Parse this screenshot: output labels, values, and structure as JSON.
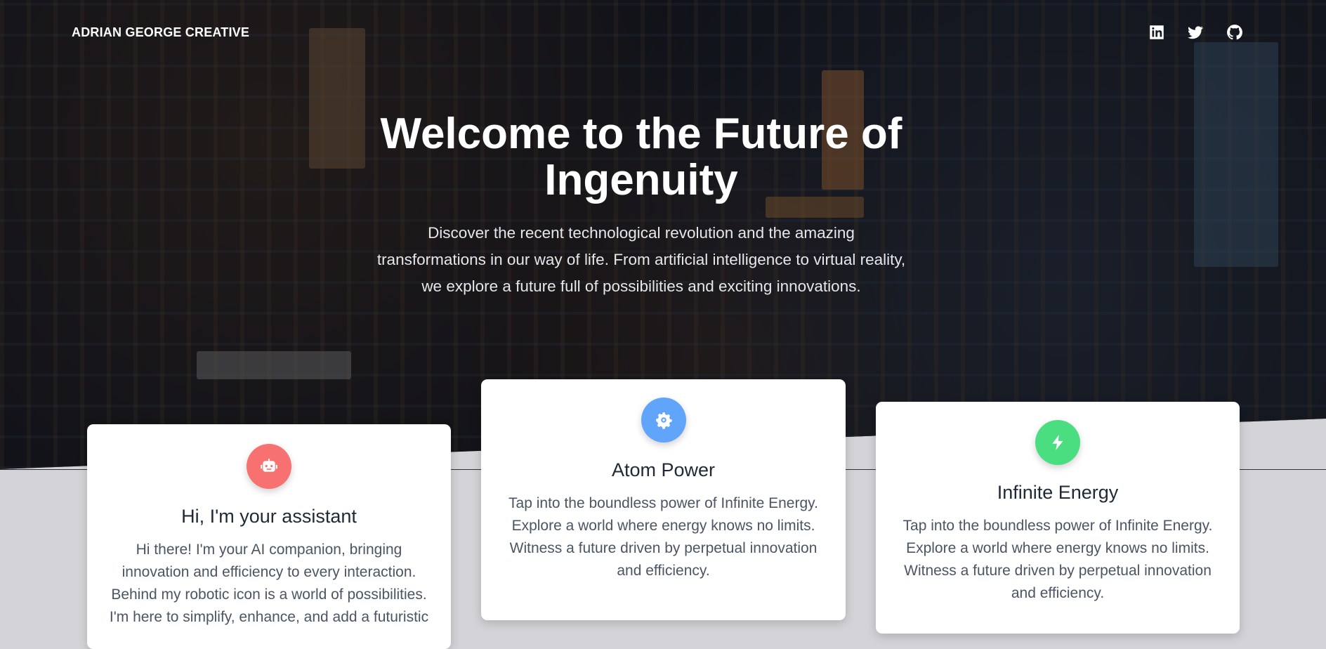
{
  "nav": {
    "brand": "ADRIAN GEORGE CREATIVE",
    "social": [
      {
        "icon": "linkedin-icon"
      },
      {
        "icon": "twitter-icon"
      },
      {
        "icon": "github-icon"
      }
    ]
  },
  "hero": {
    "title": "Welcome to the Future of Ingenuity",
    "subtitle": "Discover the recent technological revolution and the amazing transformations in our way of life. From artificial intelligence to virtual reality, we explore a future full of possibilities and exciting innovations."
  },
  "cards": [
    {
      "icon": "robot-icon",
      "color": "#f87171",
      "title": "Hi, I'm your assistant",
      "text": "Hi there! I'm your AI companion, bringing innovation and efficiency to every interaction. Behind my robotic icon is a world of possibilities. I'm here to simplify, enhance, and add a futuristic"
    },
    {
      "icon": "atom-gear-icon",
      "color": "#60a5fa",
      "title": "Atom Power",
      "text": "Tap into the boundless power of Infinite Energy. Explore a world where energy knows no limits. Witness a future driven by perpetual innovation and efficiency."
    },
    {
      "icon": "lightning-bolt-icon",
      "color": "#4ade80",
      "title": "Infinite Energy",
      "text": "Tap into the boundless power of Infinite Energy. Explore a world where energy knows no limits. Witness a future driven by perpetual innovation and efficiency."
    }
  ]
}
